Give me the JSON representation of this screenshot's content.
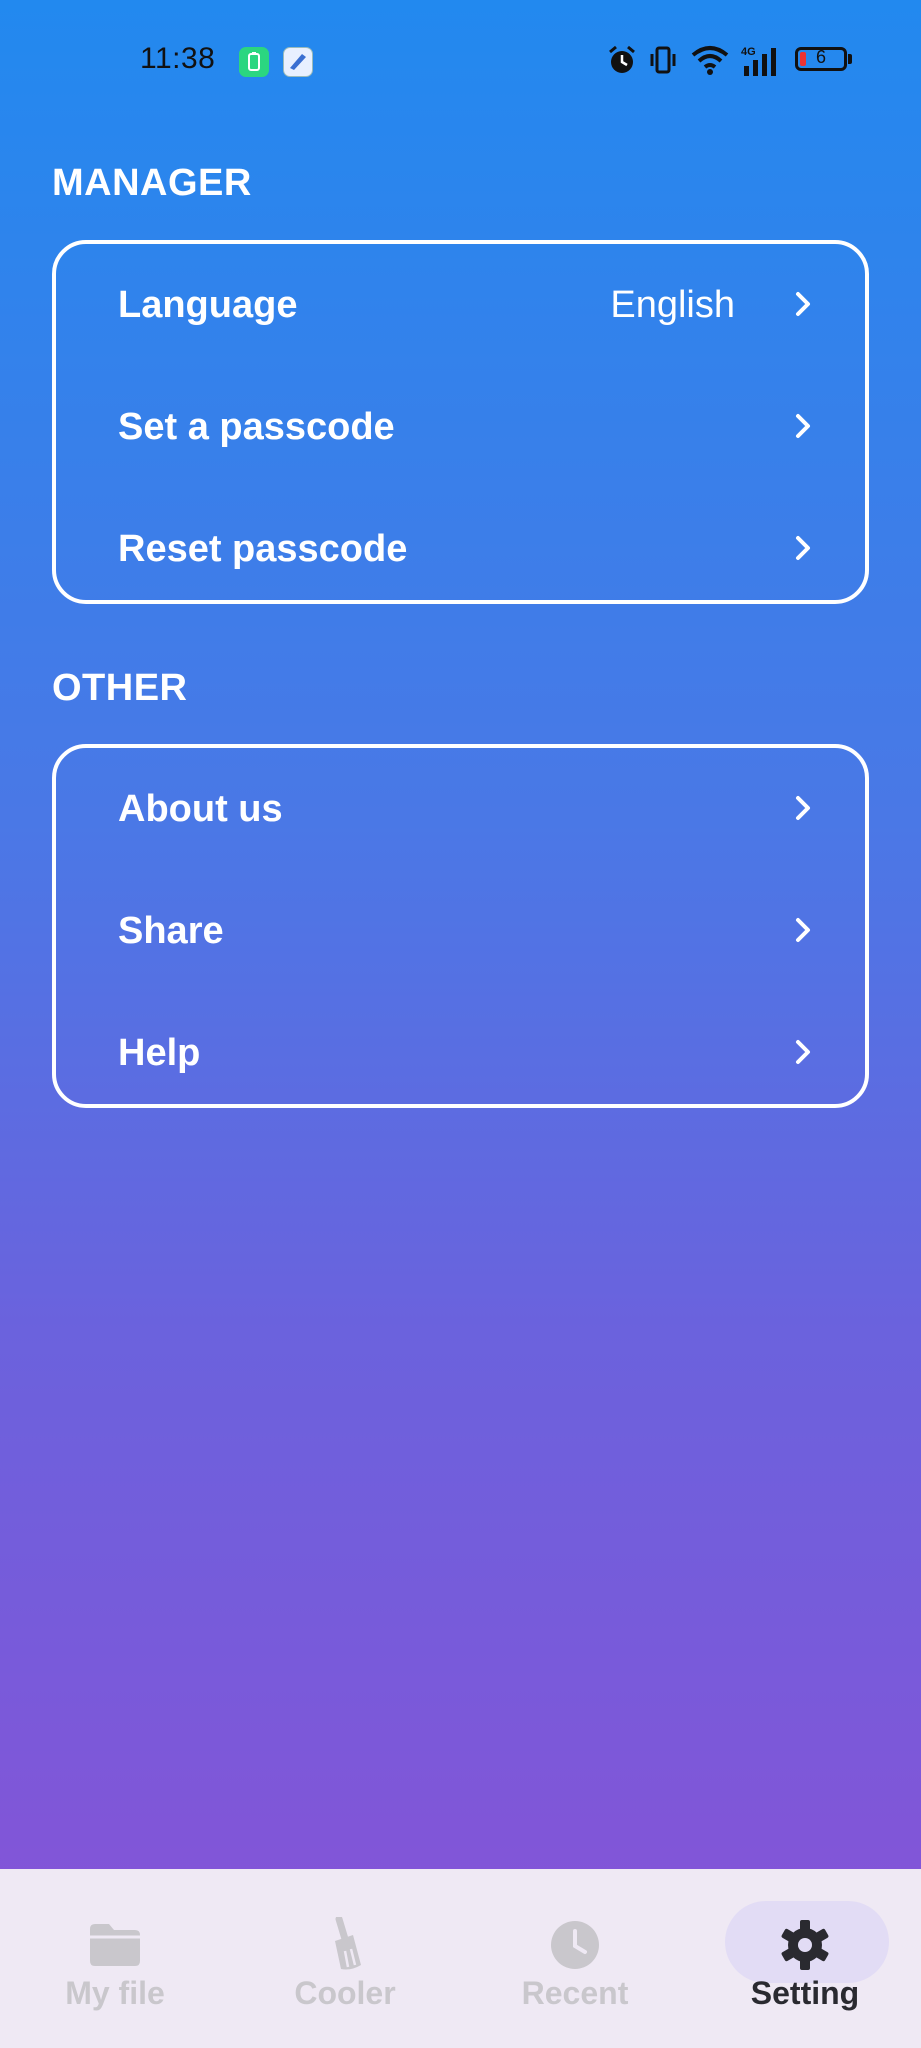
{
  "status": {
    "time": "11:38",
    "battery": "6"
  },
  "sections": [
    {
      "title": "MANAGER",
      "rows": [
        {
          "label": "Language",
          "value": "English"
        },
        {
          "label": "Set a passcode"
        },
        {
          "label": "Reset passcode"
        }
      ]
    },
    {
      "title": "OTHER",
      "rows": [
        {
          "label": "About us"
        },
        {
          "label": "Share"
        },
        {
          "label": "Help"
        }
      ]
    }
  ],
  "nav": {
    "items": [
      {
        "label": "My file",
        "icon": "folder-icon"
      },
      {
        "label": "Cooler",
        "icon": "broom-icon"
      },
      {
        "label": "Recent",
        "icon": "clock-icon"
      },
      {
        "label": "Setting",
        "icon": "gear-icon"
      }
    ],
    "active": "Setting"
  }
}
